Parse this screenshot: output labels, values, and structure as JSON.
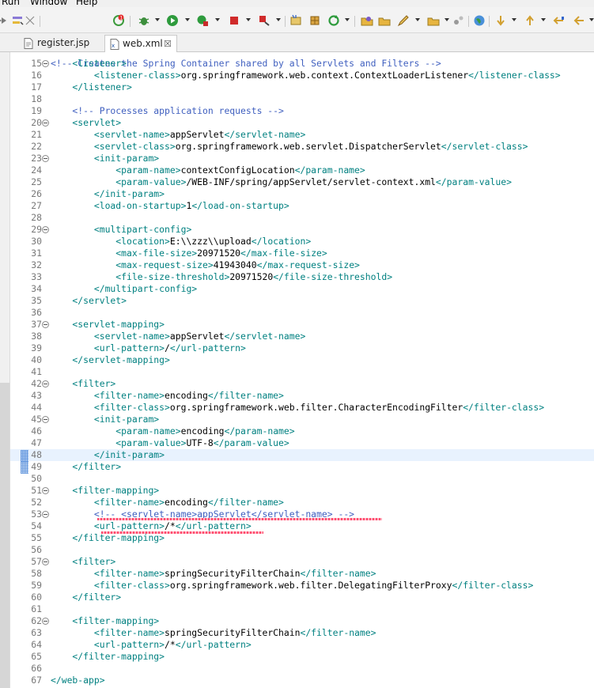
{
  "menu": {
    "items": [
      "Run",
      "Window",
      "Help"
    ]
  },
  "toolbar": {
    "icons": [
      "skip-icon",
      "mark-occurrences-icon",
      "toggle-icon",
      "errors-icon",
      "debug-icon",
      "run-icon",
      "coverage-icon",
      "stop-icon",
      "external-tools-icon",
      "new-server-icon",
      "package-icon",
      "refresh-icon",
      "open-type-icon",
      "open-folder-icon",
      "edit-icon",
      "open-task-icon",
      "toggle-block-icon",
      "globe-icon",
      "next-annotation-icon",
      "previous-annotation-icon",
      "last-edit-icon",
      "back-icon"
    ]
  },
  "tabs": [
    {
      "label": "register.jsp",
      "icon": "jsp-file-icon",
      "active": false
    },
    {
      "label": "web.xml",
      "icon": "xml-file-icon",
      "active": true,
      "close": "☒"
    }
  ],
  "editor": {
    "current_line": 48,
    "overflow_fragment": "<!-- Creates the Spring Container shared by all Servlets and Filters -->",
    "lines": [
      {
        "n": "15",
        "fold": true,
        "parts": [
          [
            "t",
            "    <listener>"
          ]
        ]
      },
      {
        "n": "16",
        "fold": false,
        "parts": [
          [
            "t",
            "        <listener-class>"
          ],
          [
            "x",
            "org.springframework.web.context.ContextLoaderListener"
          ],
          [
            "t",
            "</listener-class>"
          ]
        ]
      },
      {
        "n": "17",
        "fold": false,
        "parts": [
          [
            "t",
            "    </listener>"
          ]
        ]
      },
      {
        "n": "18",
        "fold": false,
        "parts": []
      },
      {
        "n": "19",
        "fold": false,
        "parts": [
          [
            "c",
            "    <!-- Processes application requests -->"
          ]
        ]
      },
      {
        "n": "20",
        "fold": true,
        "parts": [
          [
            "t",
            "    <servlet>"
          ]
        ]
      },
      {
        "n": "21",
        "fold": false,
        "parts": [
          [
            "t",
            "        <servlet-name>"
          ],
          [
            "x",
            "appServlet"
          ],
          [
            "t",
            "</servlet-name>"
          ]
        ]
      },
      {
        "n": "22",
        "fold": false,
        "parts": [
          [
            "t",
            "        <servlet-class>"
          ],
          [
            "x",
            "org.springframework.web.servlet.DispatcherServlet"
          ],
          [
            "t",
            "</servlet-class>"
          ]
        ]
      },
      {
        "n": "23",
        "fold": true,
        "parts": [
          [
            "t",
            "        <init-param>"
          ]
        ]
      },
      {
        "n": "24",
        "fold": false,
        "parts": [
          [
            "t",
            "            <param-name>"
          ],
          [
            "x",
            "contextConfigLocation"
          ],
          [
            "t",
            "</param-name>"
          ]
        ]
      },
      {
        "n": "25",
        "fold": false,
        "parts": [
          [
            "t",
            "            <param-value>"
          ],
          [
            "x",
            "/WEB-INF/spring/appServlet/servlet-context.xml"
          ],
          [
            "t",
            "</param-value>"
          ]
        ]
      },
      {
        "n": "26",
        "fold": false,
        "parts": [
          [
            "t",
            "        </init-param>"
          ]
        ]
      },
      {
        "n": "27",
        "fold": false,
        "parts": [
          [
            "t",
            "        <load-on-startup>"
          ],
          [
            "x",
            "1"
          ],
          [
            "t",
            "</load-on-startup>"
          ]
        ]
      },
      {
        "n": "28",
        "fold": false,
        "parts": []
      },
      {
        "n": "29",
        "fold": true,
        "parts": [
          [
            "t",
            "        <multipart-config>"
          ]
        ]
      },
      {
        "n": "30",
        "fold": false,
        "parts": [
          [
            "t",
            "            <location>"
          ],
          [
            "x",
            "E:\\\\zzz\\\\upload"
          ],
          [
            "t",
            "</location>"
          ]
        ]
      },
      {
        "n": "31",
        "fold": false,
        "parts": [
          [
            "t",
            "            <max-file-size>"
          ],
          [
            "x",
            "20971520"
          ],
          [
            "t",
            "</max-file-size>"
          ]
        ]
      },
      {
        "n": "32",
        "fold": false,
        "parts": [
          [
            "t",
            "            <max-request-size>"
          ],
          [
            "x",
            "41943040"
          ],
          [
            "t",
            "</max-request-size>"
          ]
        ]
      },
      {
        "n": "33",
        "fold": false,
        "parts": [
          [
            "t",
            "            <file-size-threshold>"
          ],
          [
            "x",
            "20971520"
          ],
          [
            "t",
            "</file-size-threshold>"
          ]
        ]
      },
      {
        "n": "34",
        "fold": false,
        "parts": [
          [
            "t",
            "        </multipart-config>"
          ]
        ]
      },
      {
        "n": "35",
        "fold": false,
        "parts": [
          [
            "t",
            "    </servlet>"
          ]
        ]
      },
      {
        "n": "36",
        "fold": false,
        "parts": []
      },
      {
        "n": "37",
        "fold": true,
        "parts": [
          [
            "t",
            "    <servlet-mapping>"
          ]
        ]
      },
      {
        "n": "38",
        "fold": false,
        "parts": [
          [
            "t",
            "        <servlet-name>"
          ],
          [
            "x",
            "appServlet"
          ],
          [
            "t",
            "</servlet-name>"
          ]
        ]
      },
      {
        "n": "39",
        "fold": false,
        "parts": [
          [
            "t",
            "        <url-pattern>"
          ],
          [
            "x",
            "/"
          ],
          [
            "t",
            "</url-pattern>"
          ]
        ]
      },
      {
        "n": "40",
        "fold": false,
        "parts": [
          [
            "t",
            "    </servlet-mapping>"
          ]
        ]
      },
      {
        "n": "41",
        "fold": false,
        "parts": []
      },
      {
        "n": "42",
        "fold": true,
        "parts": [
          [
            "t",
            "    <filter>"
          ]
        ]
      },
      {
        "n": "43",
        "fold": false,
        "parts": [
          [
            "t",
            "        <filter-name>"
          ],
          [
            "x",
            "encoding"
          ],
          [
            "t",
            "</filter-name>"
          ]
        ]
      },
      {
        "n": "44",
        "fold": false,
        "parts": [
          [
            "t",
            "        <filter-class>"
          ],
          [
            "x",
            "org.springframework.web.filter.CharacterEncodingFilter"
          ],
          [
            "t",
            "</filter-class>"
          ]
        ]
      },
      {
        "n": "45",
        "fold": true,
        "parts": [
          [
            "t",
            "        <init-param>"
          ]
        ]
      },
      {
        "n": "46",
        "fold": false,
        "parts": [
          [
            "t",
            "            <param-name>"
          ],
          [
            "x",
            "encoding"
          ],
          [
            "t",
            "</param-name>"
          ]
        ]
      },
      {
        "n": "47",
        "fold": false,
        "parts": [
          [
            "t",
            "            <param-value>"
          ],
          [
            "x",
            "UTF-8"
          ],
          [
            "t",
            "</param-value>"
          ]
        ]
      },
      {
        "n": "48",
        "fold": false,
        "parts": [
          [
            "t",
            "        </init-param>"
          ]
        ]
      },
      {
        "n": "49",
        "fold": false,
        "parts": [
          [
            "t",
            "    </filter>"
          ]
        ]
      },
      {
        "n": "50",
        "fold": false,
        "parts": []
      },
      {
        "n": "51",
        "fold": true,
        "parts": [
          [
            "t",
            "    <filter-mapping>"
          ]
        ]
      },
      {
        "n": "52",
        "fold": false,
        "parts": [
          [
            "t",
            "        <filter-name>"
          ],
          [
            "x",
            "encoding"
          ],
          [
            "t",
            "</filter-name>"
          ]
        ]
      },
      {
        "n": "53",
        "fold": true,
        "parts": [
          [
            "c",
            "        <!-- <servlet-name>appServlet</servlet-name> -->"
          ]
        ]
      },
      {
        "n": "54",
        "fold": false,
        "parts": [
          [
            "t",
            "        <url-pattern>"
          ],
          [
            "x",
            "/*"
          ],
          [
            "t",
            "</url-pattern>"
          ]
        ]
      },
      {
        "n": "55",
        "fold": false,
        "parts": [
          [
            "t",
            "    </filter-mapping>"
          ]
        ]
      },
      {
        "n": "56",
        "fold": false,
        "parts": []
      },
      {
        "n": "57",
        "fold": true,
        "parts": [
          [
            "t",
            "    <filter>"
          ]
        ]
      },
      {
        "n": "58",
        "fold": false,
        "parts": [
          [
            "t",
            "        <filter-name>"
          ],
          [
            "x",
            "springSecurityFilterChain"
          ],
          [
            "t",
            "</filter-name>"
          ]
        ]
      },
      {
        "n": "59",
        "fold": false,
        "parts": [
          [
            "t",
            "        <filter-class>"
          ],
          [
            "x",
            "org.springframework.web.filter.DelegatingFilterProxy"
          ],
          [
            "t",
            "</filter-class>"
          ]
        ]
      },
      {
        "n": "60",
        "fold": false,
        "parts": [
          [
            "t",
            "    </filter>"
          ]
        ]
      },
      {
        "n": "61",
        "fold": false,
        "parts": []
      },
      {
        "n": "62",
        "fold": true,
        "parts": [
          [
            "t",
            "    <filter-mapping>"
          ]
        ]
      },
      {
        "n": "63",
        "fold": false,
        "parts": [
          [
            "t",
            "        <filter-name>"
          ],
          [
            "x",
            "springSecurityFilterChain"
          ],
          [
            "t",
            "</filter-name>"
          ]
        ]
      },
      {
        "n": "64",
        "fold": false,
        "parts": [
          [
            "t",
            "        <url-pattern>"
          ],
          [
            "x",
            "/*"
          ],
          [
            "t",
            "</url-pattern>"
          ]
        ]
      },
      {
        "n": "65",
        "fold": false,
        "parts": [
          [
            "t",
            "    </filter-mapping>"
          ]
        ]
      },
      {
        "n": "66",
        "fold": false,
        "parts": []
      },
      {
        "n": "67",
        "fold": false,
        "parts": [
          [
            "t",
            "</web-app>"
          ]
        ]
      }
    ]
  },
  "colors": {
    "tag": "#008080",
    "comment": "#3f5fbf",
    "text": "#000000",
    "line_number": "#787878",
    "current_line": "#e8f2fe",
    "error_underline": "#ff4b6e"
  }
}
